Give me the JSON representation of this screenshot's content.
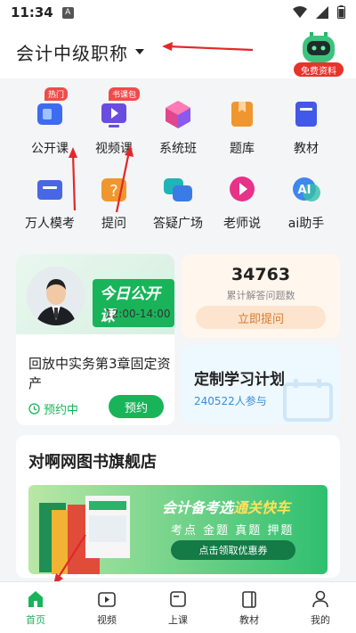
{
  "status_bar": {
    "time": "11:34",
    "a_label": "A"
  },
  "header": {
    "title": "会计中级职称",
    "badge": "免费资料"
  },
  "grid": [
    {
      "label": "公开课",
      "tag": "热门",
      "icon": "video-lesson-icon",
      "color": "#3d6cf0"
    },
    {
      "label": "视频课",
      "tag": "书课包",
      "icon": "play-screen-icon",
      "color": "#6a4de0"
    },
    {
      "label": "系统班",
      "tag": "",
      "icon": "cube-icon",
      "color": "#e0478c"
    },
    {
      "label": "题库",
      "tag": "",
      "icon": "bookmark-book-icon",
      "color": "#f0962e"
    },
    {
      "label": "教材",
      "tag": "",
      "icon": "textbook-icon",
      "color": "#4258e8"
    },
    {
      "label": "万人模考",
      "tag": "",
      "icon": "exam-card-icon",
      "color": "#4867e6"
    },
    {
      "label": "提问",
      "tag": "",
      "icon": "question-icon",
      "color": "#f0962e"
    },
    {
      "label": "答疑广场",
      "tag": "",
      "icon": "chat-bubbles-icon",
      "color": "#20b4b7"
    },
    {
      "label": "老师说",
      "tag": "",
      "icon": "play-circle-icon",
      "color": "#e8328a"
    },
    {
      "label": "ai助手",
      "tag": "",
      "icon": "ai-assistant-icon",
      "color": "#3e86f0"
    }
  ],
  "live": {
    "badge": "今日公开课",
    "time": "12:00-14:00",
    "course": "回放中实务第3章固定资产",
    "status": "预约中",
    "button": "预约"
  },
  "count": {
    "number": "34763",
    "sub": "累计解答问题数",
    "button": "立即提问"
  },
  "plan": {
    "title": "定制学习计划",
    "sub": "240522人参与"
  },
  "store": {
    "title": "对啊网图书旗舰店",
    "banner_line1_a": "会计备考选",
    "banner_line1_b": "通关快车",
    "banner_line2": "考点 金题 真题 押题",
    "banner_button": "点击领取优惠券"
  },
  "tabs": [
    {
      "label": "首页",
      "icon": "home-icon",
      "active": true
    },
    {
      "label": "视频",
      "icon": "video-icon",
      "active": false
    },
    {
      "label": "上课",
      "icon": "class-icon",
      "active": false
    },
    {
      "label": "教材",
      "icon": "book-icon",
      "active": false
    },
    {
      "label": "我的",
      "icon": "profile-icon",
      "active": false
    }
  ],
  "colors": {
    "accent": "#19b45a",
    "annotation": "#e0282b"
  }
}
